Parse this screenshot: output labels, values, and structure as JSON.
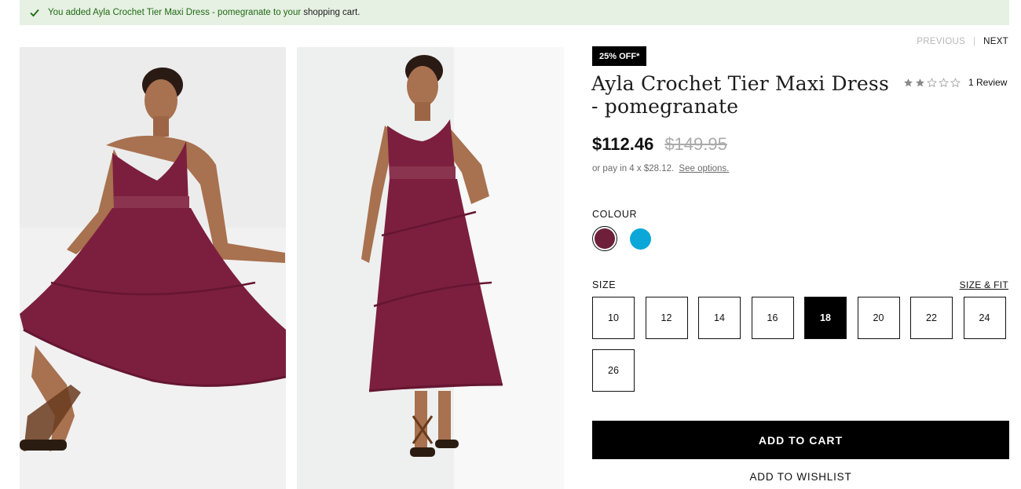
{
  "banner": {
    "message_prefix": "You added Ayla Crochet Tier Maxi Dress - pomegranate to your",
    "cart_link": "shopping cart."
  },
  "gallery": {
    "images": [
      {
        "alt": "model-seated"
      },
      {
        "alt": "model-standing"
      }
    ]
  },
  "pager": {
    "previous": "PREVIOUS",
    "separator": "|",
    "next": "NEXT"
  },
  "product": {
    "badge": "25% OFF*",
    "title": "Ayla Crochet Tier Maxi Dress - pomegranate",
    "rating": {
      "value": 2,
      "max": 5,
      "review_text": "1 Review"
    },
    "price_now": "$112.46",
    "price_was": "$149.95",
    "installments_text": "or pay in 4 x $28.12.",
    "installments_link": "See options."
  },
  "colour": {
    "label": "COLOUR",
    "swatches": [
      {
        "name": "pomegranate",
        "hex": "#6e1f3a",
        "selected": true
      },
      {
        "name": "blue",
        "hex": "#0aa7d8",
        "selected": false
      }
    ]
  },
  "size": {
    "label": "SIZE",
    "fit_link": "SIZE & FIT",
    "options": [
      "10",
      "12",
      "14",
      "16",
      "18",
      "20",
      "22",
      "24",
      "26"
    ],
    "selected": "18"
  },
  "actions": {
    "add_to_cart": "ADD TO CART",
    "add_to_wishlist": "ADD TO WISHLIST"
  },
  "colors": {
    "banner_bg": "#e6f0e3",
    "banner_text": "#1f6b12",
    "dress": "#7c1f3f",
    "skin": "#a8714f"
  }
}
